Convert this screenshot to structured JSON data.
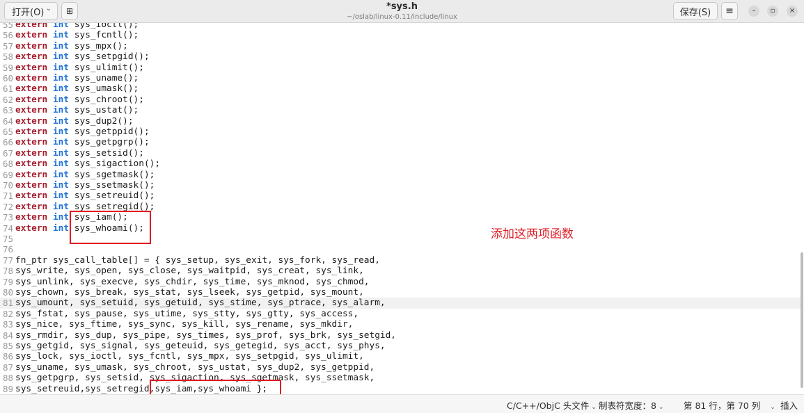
{
  "header": {
    "open_label": "打开(O)",
    "new_tab_glyph": "⊞",
    "title": "*sys.h",
    "path": "~/oslab/linux-0.11/include/linux",
    "save_label": "保存(S)",
    "menu_glyph": "≡",
    "minimize_glyph": "–",
    "maximize_glyph": "▫",
    "close_glyph": "×"
  },
  "editor": {
    "current_line": 81,
    "lines": [
      {
        "n": "55",
        "kw": true,
        "text": "sys_ioctl();"
      },
      {
        "n": "56",
        "kw": true,
        "text": "sys_fcntl();"
      },
      {
        "n": "57",
        "kw": true,
        "text": "sys_mpx();"
      },
      {
        "n": "58",
        "kw": true,
        "text": "sys_setpgid();"
      },
      {
        "n": "59",
        "kw": true,
        "text": "sys_ulimit();"
      },
      {
        "n": "60",
        "kw": true,
        "text": "sys_uname();"
      },
      {
        "n": "61",
        "kw": true,
        "text": "sys_umask();"
      },
      {
        "n": "62",
        "kw": true,
        "text": "sys_chroot();"
      },
      {
        "n": "63",
        "kw": true,
        "text": "sys_ustat();"
      },
      {
        "n": "64",
        "kw": true,
        "text": "sys_dup2();"
      },
      {
        "n": "65",
        "kw": true,
        "text": "sys_getppid();"
      },
      {
        "n": "66",
        "kw": true,
        "text": "sys_getpgrp();"
      },
      {
        "n": "67",
        "kw": true,
        "text": "sys_setsid();"
      },
      {
        "n": "68",
        "kw": true,
        "text": "sys_sigaction();"
      },
      {
        "n": "69",
        "kw": true,
        "text": "sys_sgetmask();"
      },
      {
        "n": "70",
        "kw": true,
        "text": "sys_ssetmask();"
      },
      {
        "n": "71",
        "kw": true,
        "text": "sys_setreuid();"
      },
      {
        "n": "72",
        "kw": true,
        "text": "sys_setregid();"
      },
      {
        "n": "73",
        "kw": true,
        "text": "sys_iam();"
      },
      {
        "n": "74",
        "kw": true,
        "text": "sys_whoami();"
      },
      {
        "n": "75",
        "kw": false,
        "text": ""
      },
      {
        "n": "76",
        "kw": false,
        "text": ""
      },
      {
        "n": "77",
        "kw": false,
        "text": "fn_ptr sys_call_table[] = { sys_setup, sys_exit, sys_fork, sys_read,"
      },
      {
        "n": "78",
        "kw": false,
        "text": "sys_write, sys_open, sys_close, sys_waitpid, sys_creat, sys_link,"
      },
      {
        "n": "79",
        "kw": false,
        "text": "sys_unlink, sys_execve, sys_chdir, sys_time, sys_mknod, sys_chmod,"
      },
      {
        "n": "80",
        "kw": false,
        "text": "sys_chown, sys_break, sys_stat, sys_lseek, sys_getpid, sys_mount,"
      },
      {
        "n": "81",
        "kw": false,
        "text": "sys_umount, sys_setuid, sys_getuid, sys_stime, sys_ptrace, sys_alarm,"
      },
      {
        "n": "82",
        "kw": false,
        "text": "sys_fstat, sys_pause, sys_utime, sys_stty, sys_gtty, sys_access,"
      },
      {
        "n": "83",
        "kw": false,
        "text": "sys_nice, sys_ftime, sys_sync, sys_kill, sys_rename, sys_mkdir,"
      },
      {
        "n": "84",
        "kw": false,
        "text": "sys_rmdir, sys_dup, sys_pipe, sys_times, sys_prof, sys_brk, sys_setgid,"
      },
      {
        "n": "85",
        "kw": false,
        "text": "sys_getgid, sys_signal, sys_geteuid, sys_getegid, sys_acct, sys_phys,"
      },
      {
        "n": "86",
        "kw": false,
        "text": "sys_lock, sys_ioctl, sys_fcntl, sys_mpx, sys_setpgid, sys_ulimit,"
      },
      {
        "n": "87",
        "kw": false,
        "text": "sys_uname, sys_umask, sys_chroot, sys_ustat, sys_dup2, sys_getppid,"
      },
      {
        "n": "88",
        "kw": false,
        "text": "sys_getpgrp, sys_setsid, sys_sigaction, sys_sgetmask, sys_ssetmask,"
      },
      {
        "n": "89",
        "kw": false,
        "text": "sys_setreuid,sys_setregid,sys_iam,sys_whoami };"
      }
    ]
  },
  "annotation": {
    "text": "添加这两项函数",
    "color": "#e01b24"
  },
  "statusbar": {
    "language": "C/C++/ObjC 头文件",
    "tab_width": "制表符宽度：8",
    "position": "第 81 行，第 70 列",
    "mode": "插入"
  }
}
